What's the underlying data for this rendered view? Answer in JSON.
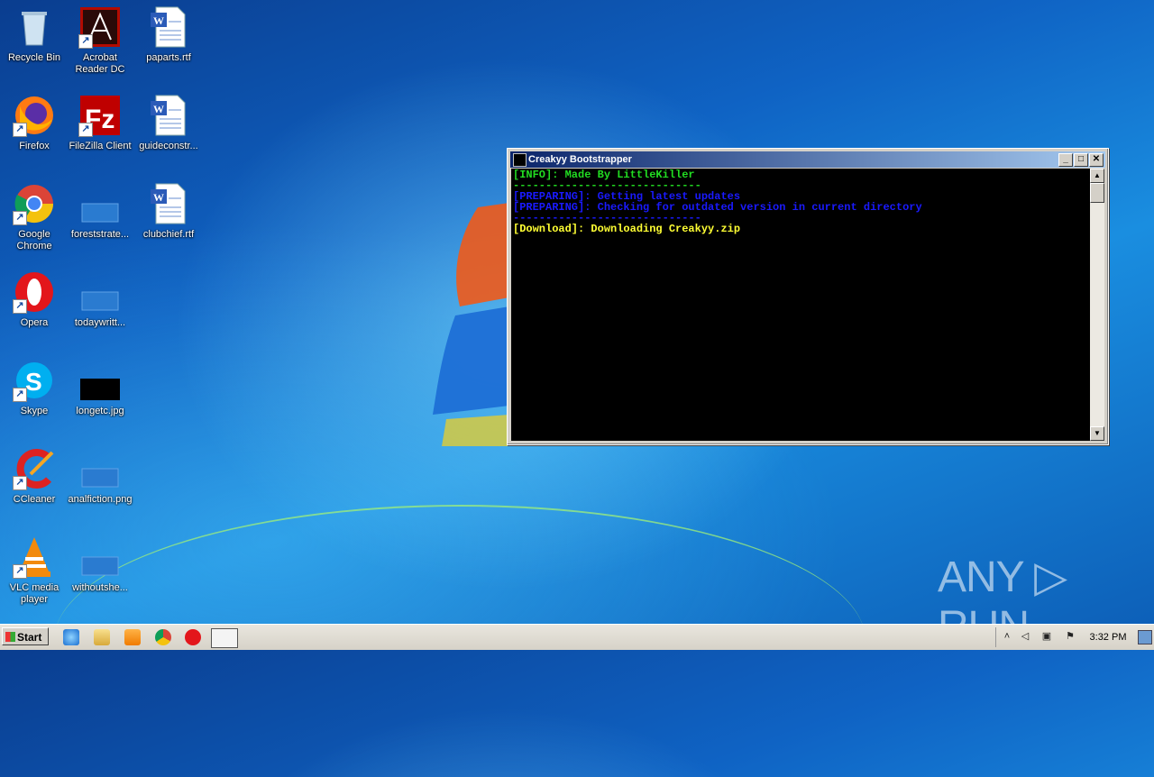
{
  "desktop": {
    "icons": [
      {
        "label": "Recycle Bin"
      },
      {
        "label": "Acrobat Reader DC"
      },
      {
        "label": "paparts.rtf"
      },
      {
        "label": "Firefox"
      },
      {
        "label": "FileZilla Client"
      },
      {
        "label": "guideconstr..."
      },
      {
        "label": "Google Chrome"
      },
      {
        "label": "foreststrate..."
      },
      {
        "label": "clubchief.rtf"
      },
      {
        "label": "Opera"
      },
      {
        "label": "todaywritt..."
      },
      {
        "label": "Skype"
      },
      {
        "label": "longetc.jpg"
      },
      {
        "label": "CCleaner"
      },
      {
        "label": "analfiction.png"
      },
      {
        "label": "VLC media player"
      },
      {
        "label": "withoutshe..."
      }
    ]
  },
  "window": {
    "title": "Creakyy Bootstrapper",
    "lines": [
      {
        "text": "[INFO]: Made By LittleKiller",
        "color": "#22dd22"
      },
      {
        "text": "-----------------------------",
        "color": "#22dd22"
      },
      {
        "text": "[PREPARING]: Getting latest updates",
        "color": "#1a1aff"
      },
      {
        "text": "[PREPARING]: Checking for outdated version in current directory",
        "color": "#1a1aff"
      },
      {
        "text": "-----------------------------",
        "color": "#1a1aff"
      },
      {
        "text": "[Download]: Downloading Creakyy.zip",
        "color": "#ffff33"
      }
    ]
  },
  "taskbar": {
    "start_label": "Start",
    "clock": "3:32 PM"
  },
  "watermark": "ANY ▷ RUN"
}
